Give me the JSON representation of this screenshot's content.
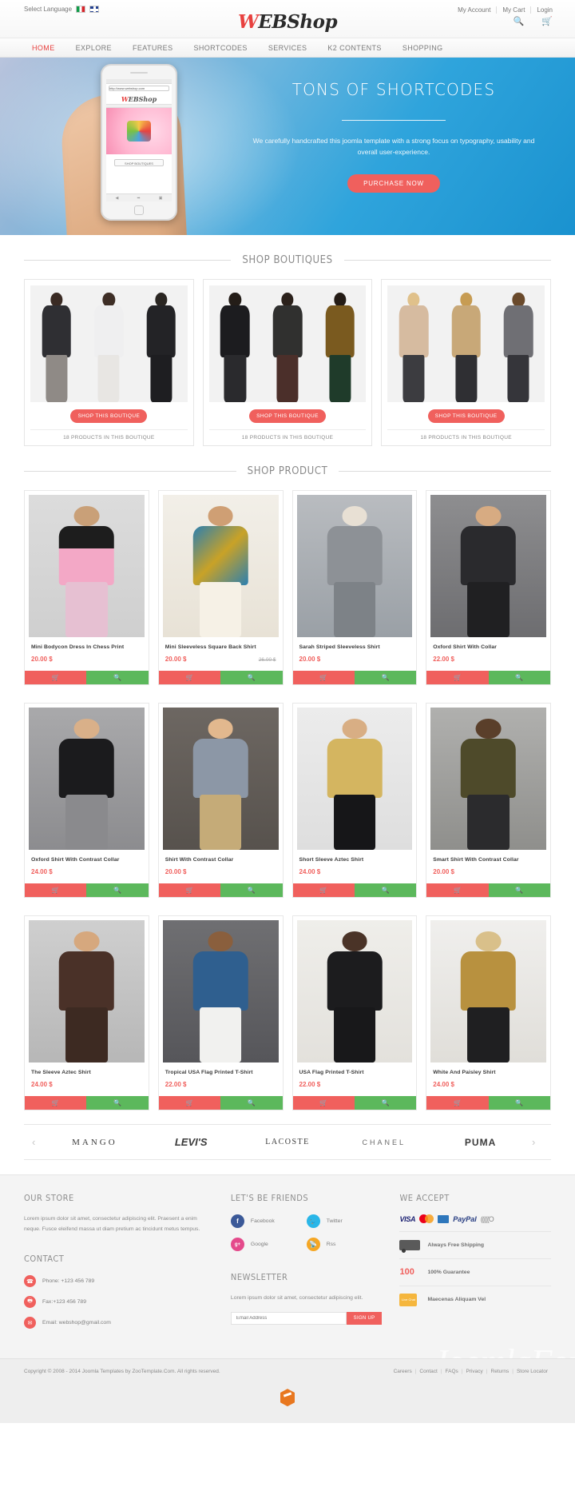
{
  "topbar": {
    "language_label": "Select Language",
    "flags": [
      "italy-flag-icon",
      "uk-flag-icon"
    ],
    "links": [
      "My Account",
      "My Cart",
      "Login"
    ],
    "logo": {
      "part1": "W",
      "part2": "EB",
      "part3": "Shop"
    },
    "search_icon": "search-icon",
    "cart_icon": "cart-icon"
  },
  "nav": {
    "items": [
      {
        "label": "HOME",
        "active": true
      },
      {
        "label": "EXPLORE",
        "active": false
      },
      {
        "label": "FEATURES",
        "active": false
      },
      {
        "label": "SHORTCODES",
        "active": false
      },
      {
        "label": "SERVICES",
        "active": false
      },
      {
        "label": "K2 CONTENTS",
        "active": false
      },
      {
        "label": "SHOPPING",
        "active": false
      }
    ]
  },
  "hero": {
    "title": "TONS OF SHORTCODES",
    "subtitle": "We carefully handcrafted this joomla template with a strong focus on typography, usability and overall user-experience.",
    "button": "PURCHASE NOW",
    "phone_logo_part1": "W",
    "phone_logo_part2": "EBShop",
    "phone_button": "SHOP BOUTIQUES",
    "phone_url": "http://www.webshop.com"
  },
  "boutiques_section": {
    "title": "SHOP BOUTIQUES",
    "items": [
      {
        "button": "SHOP THIS BOUTIQUE",
        "count": "18 PRODUCTS IN THIS BOUTIQUE"
      },
      {
        "button": "SHOP THIS BOUTIQUE",
        "count": "18 PRODUCTS IN THIS BOUTIQUE"
      },
      {
        "button": "SHOP THIS BOUTIQUE",
        "count": "18 PRODUCTS IN THIS BOUTIQUE"
      }
    ]
  },
  "products_section": {
    "title": "SHOP PRODUCT",
    "cart_icon": "shopping-cart-icon",
    "view_icon": "quick-view-icon",
    "items": [
      {
        "title": "Mini Bodycon Dress In Chess Print",
        "price": "20.00 $",
        "old_price": ""
      },
      {
        "title": "Mini Sleeveless Square Back Shirt",
        "price": "20.00 $",
        "old_price": "26.00 $"
      },
      {
        "title": "Sarah Striped Sleeveless Shirt",
        "price": "20.00 $",
        "old_price": ""
      },
      {
        "title": "Oxford Shirt With Collar",
        "price": "22.00 $",
        "old_price": ""
      },
      {
        "title": "Oxford Shirt With Contrast Collar",
        "price": "24.00 $",
        "old_price": ""
      },
      {
        "title": "Shirt With Contrast Collar",
        "price": "20.00 $",
        "old_price": ""
      },
      {
        "title": "Short Sleeve Aztec Shirt",
        "price": "24.00 $",
        "old_price": ""
      },
      {
        "title": "Smart Shirt With Contrast Collar",
        "price": "20.00 $",
        "old_price": ""
      },
      {
        "title": "The Sleeve Aztec Shirt",
        "price": "24.00 $",
        "old_price": ""
      },
      {
        "title": "Tropical USA Flag Printed T-Shirt",
        "price": "22.00 $",
        "old_price": ""
      },
      {
        "title": "USA Flag Printed T-Shirt",
        "price": "22.00 $",
        "old_price": ""
      },
      {
        "title": "White And Paisley Shirt",
        "price": "24.00 $",
        "old_price": ""
      }
    ]
  },
  "brands": {
    "prev_icon": "chevron-left-icon",
    "next_icon": "chevron-right-icon",
    "items": [
      "MANGO",
      "LEVI'S",
      "LACOSTE",
      "CHANEL",
      "PUMA"
    ]
  },
  "footer": {
    "store": {
      "title": "OUR STORE",
      "text": "Lorem ipsum dolor sit amet, consectetur adipiscing elit. Praesent a enim neque. Fusce eleifend massa ut diam pretium ac tincidunt metus tempus."
    },
    "contact": {
      "title": "CONTACT",
      "rows": [
        {
          "icon": "phone-icon",
          "text": "Phone: +123 456 789"
        },
        {
          "icon": "fax-icon",
          "text": "Fax:+123 456 789"
        },
        {
          "icon": "email-icon",
          "text": "Email: webshop@gmail.com"
        }
      ]
    },
    "friends": {
      "title": "LET'S BE FRIENDS",
      "items": [
        {
          "icon": "facebook-icon",
          "label": "Facebook",
          "color": "#3b5998",
          "glyph": "f"
        },
        {
          "icon": "twitter-icon",
          "label": "Twitter",
          "color": "#29b6e8",
          "glyph": "t"
        },
        {
          "icon": "google-plus-icon",
          "label": "Google",
          "color": "#e44a8b",
          "glyph": "g+"
        },
        {
          "icon": "rss-icon",
          "label": "Rss",
          "color": "#f5a623",
          "glyph": "r"
        }
      ]
    },
    "newsletter": {
      "title": "NEWSLETTER",
      "text": "Lorem ipsum dolor sit amet, consectetur adipiscing elit.",
      "placeholder": "Email Address",
      "button": "SIGN UP"
    },
    "accept": {
      "title": "WE ACCEPT",
      "pay_logos": [
        "VISA",
        "mastercard-icon",
        "amex-icon",
        "PayPal",
        "discover-icon"
      ],
      "rows": [
        {
          "icon": "truck-icon",
          "text": "Always Free Shipping"
        },
        {
          "icon": "guarantee-icon",
          "text": "100% Guarantee"
        },
        {
          "icon": "live-chat-icon",
          "text": "Maecenas Aliquam Vel"
        }
      ],
      "guarantee_badge": "100",
      "guarantee_badge_sub": "Guarantee",
      "guarantee_pct": "%",
      "chat_badge": "Live Chat"
    },
    "watermark": "JoomlaFox"
  },
  "copyright": {
    "text": "Copyright © 2008 - 2014 Joomla Templates by ZooTemplate.Com. All rights reserved.",
    "links": [
      "Careers",
      "Contact",
      "FAQs",
      "Privacy",
      "Returns",
      "Store Locator"
    ],
    "mark_icon": "brand-mark-icon"
  },
  "colors": {
    "accent_red": "#f0605d",
    "accent_green": "#5cb85c",
    "hero_blue": "#2fa4dc",
    "text_gray": "#8a8a8a"
  }
}
